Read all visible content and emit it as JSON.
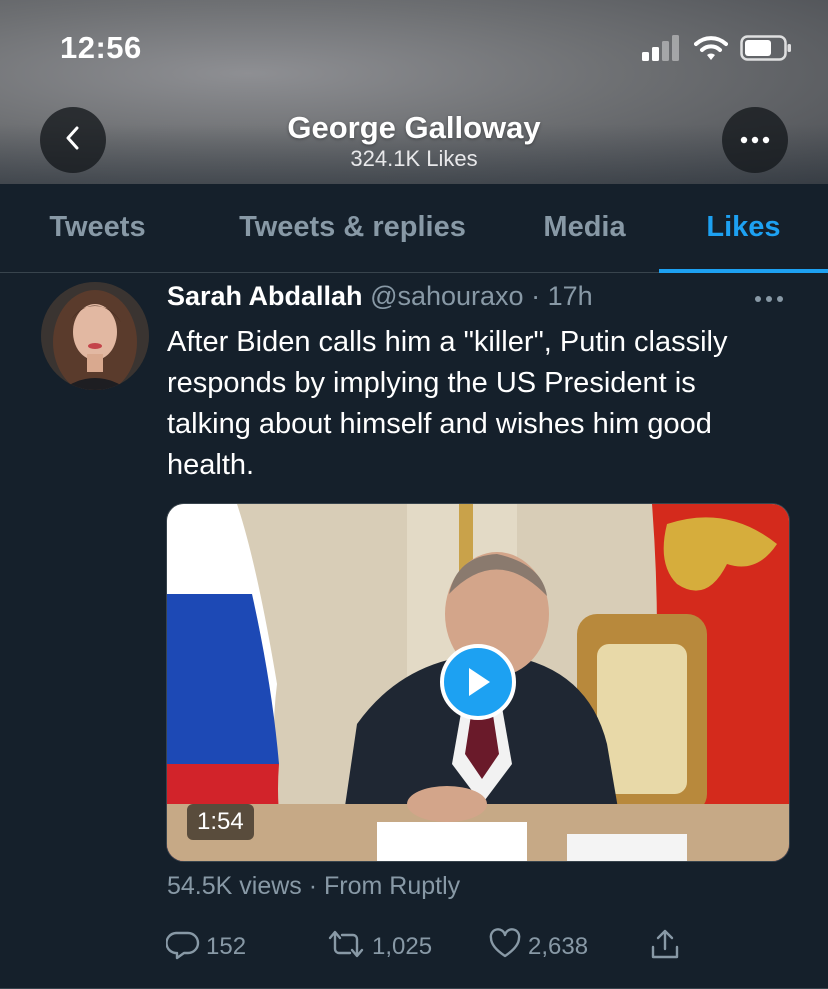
{
  "status_bar": {
    "time": "12:56",
    "icons": [
      "signal-icon",
      "wifi-icon",
      "battery-icon"
    ]
  },
  "header": {
    "title": "George Galloway",
    "subtitle": "324.1K Likes",
    "back_icon": "chevron-left-icon",
    "more_icon": "ellipsis-icon"
  },
  "tabs": [
    {
      "label": "Tweets",
      "active": false
    },
    {
      "label": "Tweets & replies",
      "active": false
    },
    {
      "label": "Media",
      "active": false
    },
    {
      "label": "Likes",
      "active": true
    }
  ],
  "tweet": {
    "author_name": "Sarah Abdallah",
    "handle": "@sahouraxo",
    "separator": "·",
    "time": "17h",
    "text": "After Biden calls him a \"killer\", Putin classily responds by implying the US President is talking about himself and wishes him good health.",
    "media": {
      "duration": "1:54",
      "play_icon": "play-icon"
    },
    "views_line": "54.5K views · From Ruptly",
    "actions": {
      "replies": "152",
      "retweets": "1,025",
      "likes": "2,638"
    }
  },
  "colors": {
    "background": "#15202b",
    "accent": "#1da1f2",
    "muted_text": "#8899a6",
    "divider": "#38444d"
  }
}
